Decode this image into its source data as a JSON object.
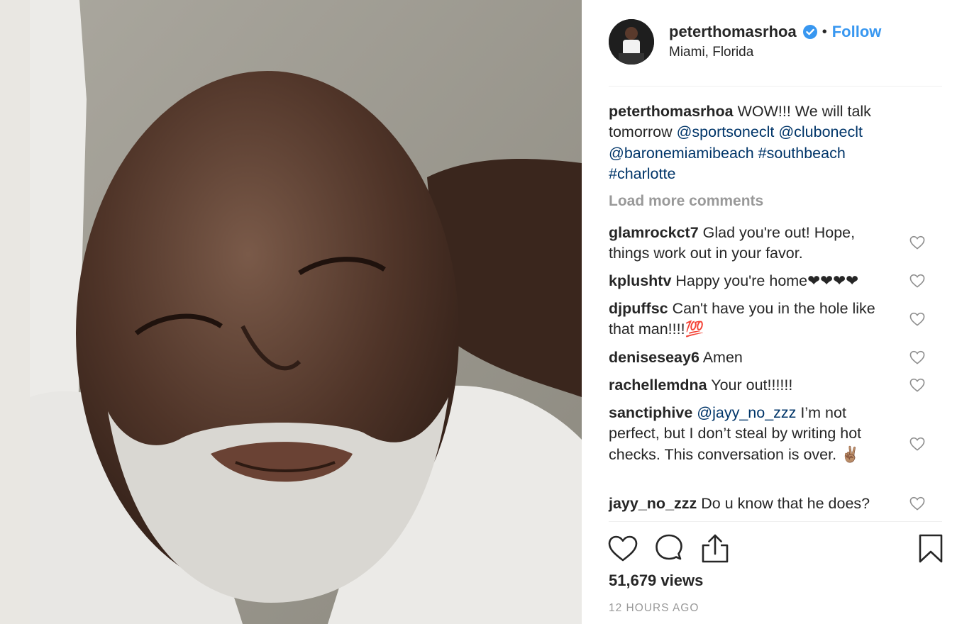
{
  "post": {
    "username": "peterthomasrhoa",
    "separator": "•",
    "follow_label": "Follow",
    "location": "Miami, Florida",
    "caption": {
      "username": "peterthomasrhoa",
      "text_1": " WOW!!! We will talk tomorrow ",
      "mention_1": "@sportsoneclt",
      "mention_2": "@cluboneclt",
      "mention_3": "@baronemiamibeach",
      "hashtag_1": "#southbeach",
      "hashtag_2": "#charlotte"
    },
    "load_more_label": "Load more comments",
    "comments": [
      {
        "username": "glamrockct7",
        "text": " Glad you're out! Hope, things work out in your favor."
      },
      {
        "username": "kplushtv",
        "text": " Happy you're home❤❤❤❤"
      },
      {
        "username": "djpuffsc",
        "text": " Can't have you in the hole like that man!!!!💯"
      },
      {
        "username": "deniseseay6",
        "text": " Amen"
      },
      {
        "username": "rachellemdna",
        "text": " Your out!!!!!!"
      },
      {
        "username": "sanctiphive",
        "mention": "@jayy_no_zzz",
        "text": " I’m not perfect, but I don’t steal by writing hot checks. This conversation is over. ✌🏽"
      },
      {
        "username": "jayy_no_zzz",
        "text": " Do u know that he does?"
      }
    ],
    "views": "51,679 views",
    "timestamp": "12 HOURS AGO"
  },
  "icons": {
    "verified": "verified-badge-icon",
    "like": "heart-icon",
    "comment": "comment-bubble-icon",
    "share": "share-icon",
    "save": "bookmark-icon"
  },
  "colors": {
    "link": "#003569",
    "follow": "#3897f0",
    "muted": "#999999",
    "text": "#262626"
  }
}
